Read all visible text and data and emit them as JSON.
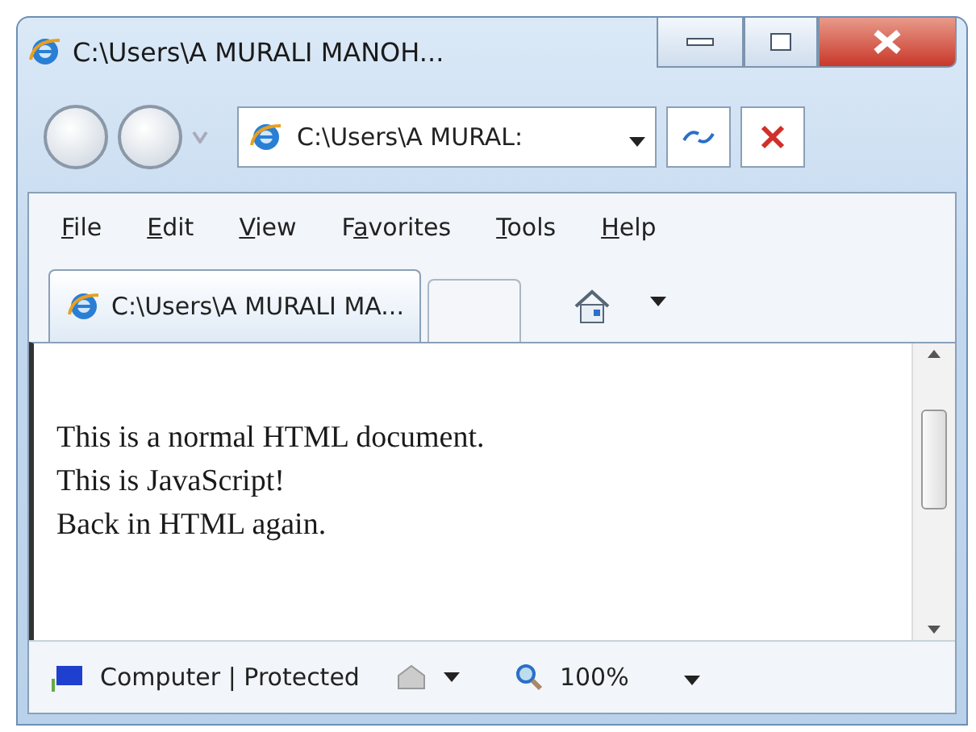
{
  "window": {
    "title": "C:\\Users\\A MURALI MANOH..."
  },
  "address_bar": {
    "value": "C:\\Users\\A MURAL:"
  },
  "menu": [
    {
      "key": "F",
      "post": "ile"
    },
    {
      "key": "E",
      "post": "dit"
    },
    {
      "key": "V",
      "post": "iew"
    },
    {
      "pre": "F",
      "key": "a",
      "post": "vorites"
    },
    {
      "key": "T",
      "post": "ools"
    },
    {
      "key": "H",
      "post": "elp"
    }
  ],
  "tabs": [
    {
      "label": "C:\\Users\\A MURALI MA...",
      "selected": true
    }
  ],
  "content": [
    "This is a normal HTML document.",
    "This is JavaScript!",
    "Back in HTML again."
  ],
  "status_bar": {
    "zone": "Computer | Protected",
    "zoom": "100%"
  }
}
